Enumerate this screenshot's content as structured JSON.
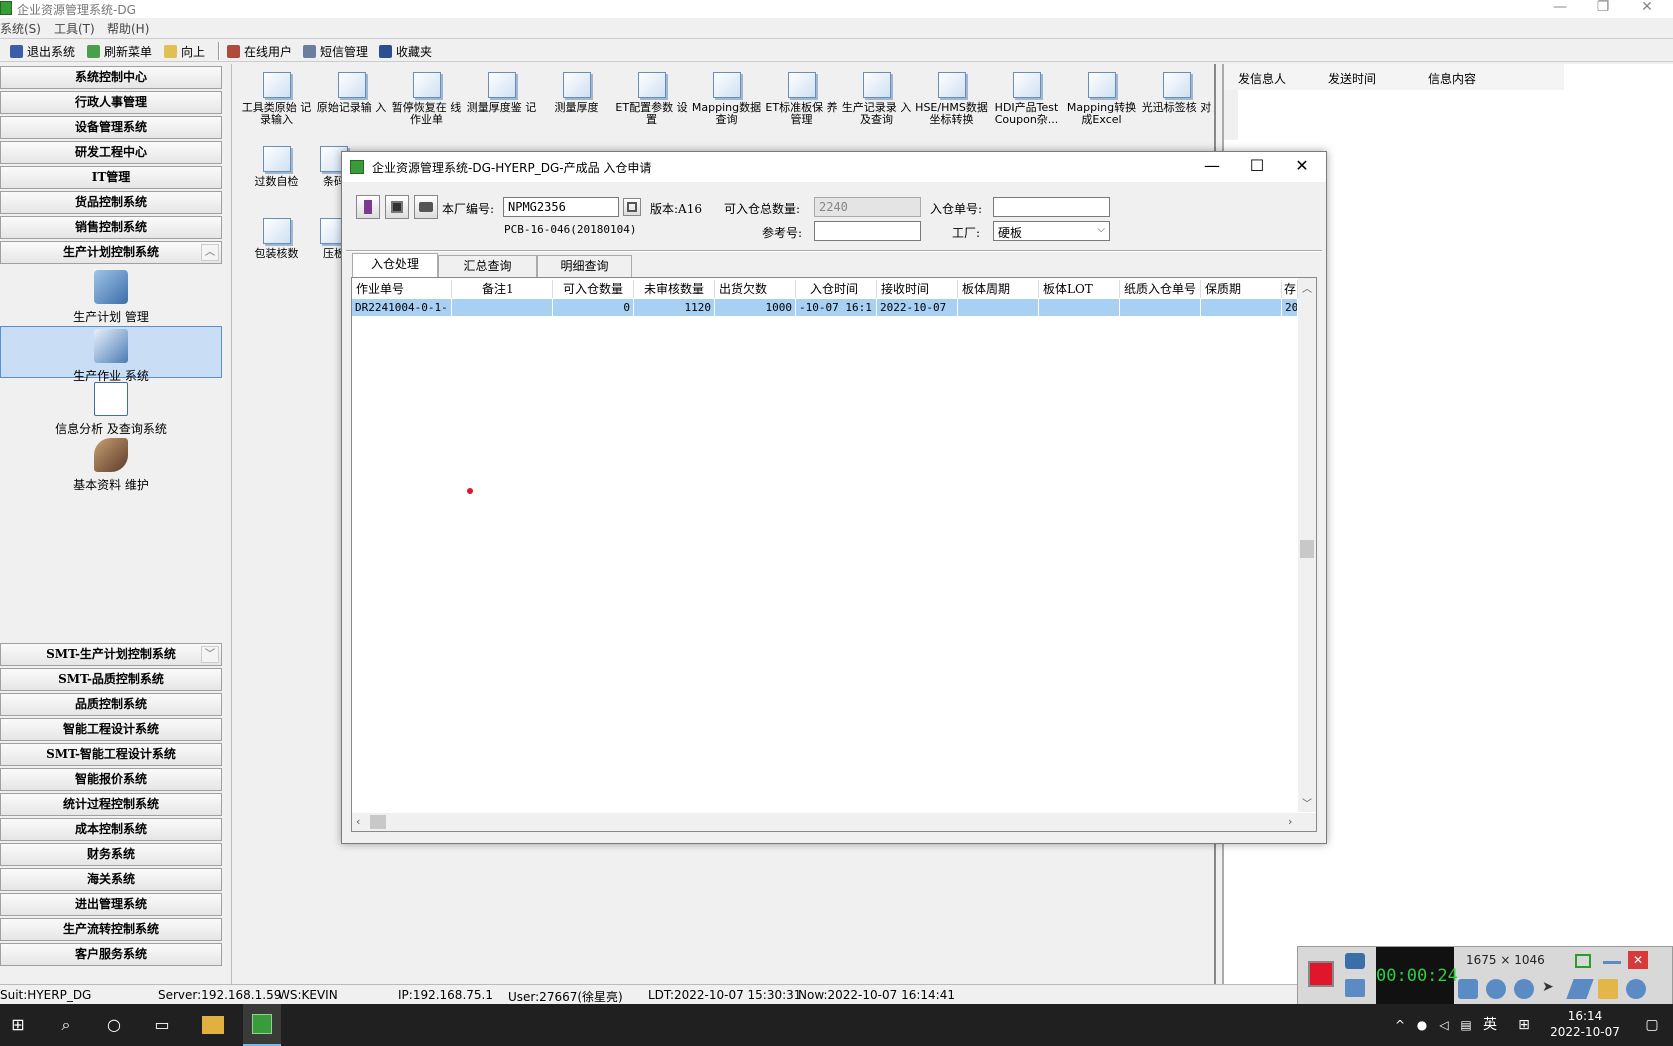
{
  "app": {
    "title": "企业资源管理系统-DG",
    "menu": [
      "系统(S)",
      "工具(T)",
      "帮助(H)"
    ]
  },
  "toolbar": {
    "items": [
      {
        "label": "退出系统",
        "icon": "exit-icon"
      },
      {
        "label": "刷新菜单",
        "icon": "refresh-icon"
      },
      {
        "label": "向上",
        "icon": "folder-up-icon"
      },
      {
        "label": "在线用户",
        "icon": "users-icon"
      },
      {
        "label": "短信管理",
        "icon": "sms-icon"
      },
      {
        "label": "收藏夹",
        "icon": "favorites-icon"
      }
    ]
  },
  "leftnav": {
    "top_groups": [
      "系统控制中心",
      "行政人事管理",
      "设备管理系统",
      "研发工程中心",
      "IT管理",
      "货品控制系统",
      "销售控制系统",
      "生产计划控制系统"
    ],
    "sub_items": [
      "生产计划 管理",
      "生产作业 系统",
      "信息分析 及查询系统",
      "基本资料 维护"
    ],
    "bottom_groups": [
      "SMT-生产计划控制系统",
      "SMT-品质控制系统",
      "品质控制系统",
      "智能工程设计系统",
      "SMT-智能工程设计系统",
      "智能报价系统",
      "统计过程控制系统",
      "成本控制系统",
      "财务系统",
      "海关系统",
      "进出管理系统",
      "生产流转控制系统",
      "客户服务系统"
    ]
  },
  "grid_icons": {
    "row1": [
      "工具类原始 记录输入",
      "原始记录输 入",
      "暂停恢复在 线作业单",
      "测量厚度鉴 记",
      "测量厚度",
      "ET配置参数 设置",
      "Mapping数据 查询",
      "ET标准板保 养管理",
      "生产记录录 入及查询",
      "HSE/HMS数据 坐标转换",
      "HDI产品Test Coupon杂...",
      "Mapping转换 成Excel",
      "光迅标签核 对"
    ],
    "row2": [
      "过数自检",
      "条码"
    ],
    "row3": [
      "包装核数",
      "压板"
    ]
  },
  "rightpanel": {
    "headers": [
      "发信息人",
      "发送时间",
      "信息内容"
    ]
  },
  "dialog": {
    "title": "企业资源管理系统-DG-HYERP_DG-产成品 入仓申请",
    "factory_no_label": "本厂编号:",
    "factory_no_value": "NPMG2356",
    "version": "版本:A16",
    "pcb_spec": "PCB-16-046(20180104)",
    "total_qty_label": "可入仓总数量:",
    "total_qty_value": "2240",
    "ref_label": "参考号:",
    "ref_value": "",
    "in_no_label": "入仓单号:",
    "in_no_value": "",
    "factory_label": "工厂:",
    "factory_value": "硬板",
    "tabs": [
      "入仓处理",
      "汇总查询",
      "明细查询"
    ],
    "columns": [
      "作业单号",
      "备注1",
      "可入仓数量",
      "未审核数量",
      "出货欠数",
      "入仓时间",
      "接收时间",
      "板体周期",
      "板体LOT",
      "纸质入仓单号",
      "保质期",
      "存"
    ],
    "rows": [
      [
        "DR2241004-0-1-",
        "",
        "0",
        "1120",
        "1000",
        "-10-07 16:1",
        "2022-10-07",
        "",
        "",
        "",
        "",
        "20"
      ]
    ]
  },
  "statusbar": {
    "suit": "Suit:HYERP_DG",
    "server": "Server:192.168.1.59",
    "ws": "WS:KEVIN",
    "ip": "IP:192.168.75.1",
    "user": "User:27667(徐星亮)",
    "ldt": "LDT:2022-10-07 15:30:31",
    "now": "Now:2022-10-07 16:14:41"
  },
  "recorder": {
    "resolution": "1675 × 1046",
    "timer": "00:00:24"
  },
  "taskbar": {
    "time": "16:14",
    "date": "2022-10-07",
    "ime": "英"
  },
  "colors": {
    "selection": "#a7d0f3",
    "nav_selected": "#c9def5",
    "taskbar": "#202020",
    "record_red": "#e0162b"
  }
}
